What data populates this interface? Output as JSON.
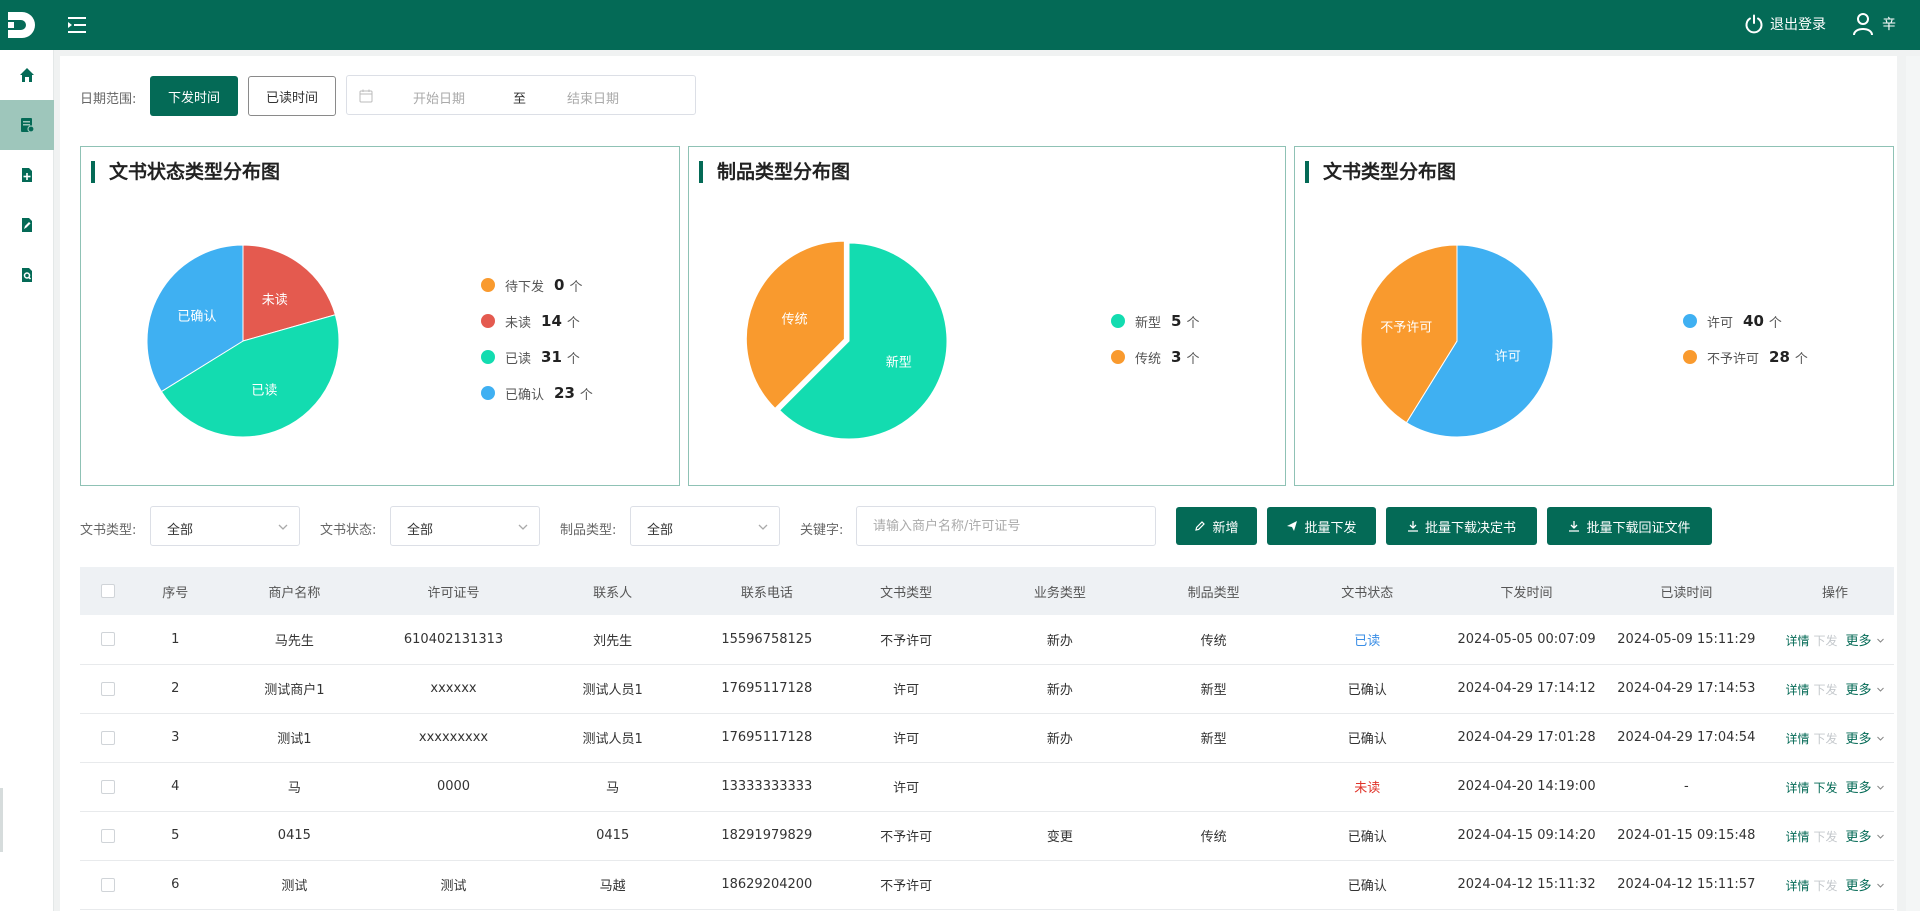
{
  "header": {
    "logout_label": "退出登录",
    "username": "辛"
  },
  "sidebar": {
    "items": [
      "home-icon",
      "document-list-icon",
      "add-file-icon",
      "edit-file-icon",
      "search-file-icon"
    ]
  },
  "filter": {
    "date_range_label": "日期范围:",
    "btn_issue_time": "下发时间",
    "btn_read_time": "已读时间",
    "start_placeholder": "开始日期",
    "separator": "至",
    "end_placeholder": "结束日期"
  },
  "colors": {
    "primary": "#046a56",
    "orange": "#f99a2e",
    "red": "#e45a4f",
    "teal": "#13dcb0",
    "blue": "#3fb0f2"
  },
  "chart_data": [
    {
      "type": "pie",
      "title": "文书状态类型分布图",
      "categories": [
        "待下发",
        "未读",
        "已读",
        "已确认"
      ],
      "values": [
        0,
        14,
        31,
        23
      ],
      "colors": [
        "#f99a2e",
        "#e45a4f",
        "#13dcb0",
        "#3fb0f2"
      ],
      "unit": "个",
      "legend": "right"
    },
    {
      "type": "pie",
      "title": "制品类型分布图",
      "categories": [
        "新型",
        "传统"
      ],
      "values": [
        5,
        3
      ],
      "colors": [
        "#13dcb0",
        "#f99a2e"
      ],
      "unit": "个",
      "legend": "right"
    },
    {
      "type": "pie",
      "title": "文书类型分布图",
      "categories": [
        "许可",
        "不予许可"
      ],
      "values": [
        40,
        28
      ],
      "colors": [
        "#3fb0f2",
        "#f99a2e"
      ],
      "unit": "个",
      "legend": "right"
    }
  ],
  "search": {
    "doc_type_label": "文书类型:",
    "doc_type_value": "全部",
    "doc_status_label": "文书状态:",
    "doc_status_value": "全部",
    "product_type_label": "制品类型:",
    "product_type_value": "全部",
    "keyword_label": "关键字:",
    "keyword_placeholder": "请输入商户名称/许可证号"
  },
  "actions": {
    "add": "新增",
    "batch_issue": "批量下发",
    "batch_download_decision": "批量下载决定书",
    "batch_download_receipt": "批量下载回证文件"
  },
  "table": {
    "columns": [
      "序号",
      "商户名称",
      "许可证号",
      "联系人",
      "联系电话",
      "文书类型",
      "业务类型",
      "制品类型",
      "文书状态",
      "下发时间",
      "已读时间",
      "操作"
    ],
    "op_detail": "详情",
    "op_issue": "下发",
    "op_more": "更多",
    "rows": [
      {
        "no": "1",
        "merchant": "马先生",
        "license": "610402131313",
        "contact": "刘先生",
        "phone": "15596758125",
        "doc_type": "不予许可",
        "biz_type": "新办",
        "product_type": "传统",
        "status": "已读",
        "status_color": "#3a8ee6",
        "issue_time": "2024-05-05 00:07:09",
        "read_time": "2024-05-09 15:11:29",
        "issue_enabled": false
      },
      {
        "no": "2",
        "merchant": "测试商户1",
        "license": "xxxxxx",
        "contact": "测试人员1",
        "phone": "17695117128",
        "doc_type": "许可",
        "biz_type": "新办",
        "product_type": "新型",
        "status": "已确认",
        "status_color": "#333333",
        "issue_time": "2024-04-29 17:14:12",
        "read_time": "2024-04-29 17:14:53",
        "issue_enabled": false
      },
      {
        "no": "3",
        "merchant": "测试1",
        "license": "xxxxxxxxx",
        "contact": "测试人员1",
        "phone": "17695117128",
        "doc_type": "许可",
        "biz_type": "新办",
        "product_type": "新型",
        "status": "已确认",
        "status_color": "#333333",
        "issue_time": "2024-04-29 17:01:28",
        "read_time": "2024-04-29 17:04:54",
        "issue_enabled": false
      },
      {
        "no": "4",
        "merchant": "马",
        "license": "0000",
        "contact": "马",
        "phone": "13333333333",
        "doc_type": "许可",
        "biz_type": "",
        "product_type": "",
        "status": "未读",
        "status_color": "#e0342a",
        "issue_time": "2024-04-20 14:19:00",
        "read_time": "-",
        "issue_enabled": true
      },
      {
        "no": "5",
        "merchant": "0415",
        "license": "",
        "contact": "0415",
        "phone": "18291979829",
        "doc_type": "不予许可",
        "biz_type": "变更",
        "product_type": "传统",
        "status": "已确认",
        "status_color": "#333333",
        "issue_time": "2024-04-15 09:14:20",
        "read_time": "2024-01-15 09:15:48",
        "issue_enabled": false
      },
      {
        "no": "6",
        "merchant": "测试",
        "license": "测试",
        "contact": "马越",
        "phone": "18629204200",
        "doc_type": "不予许可",
        "biz_type": "",
        "product_type": "",
        "status": "已确认",
        "status_color": "#333333",
        "issue_time": "2024-04-12 15:11:32",
        "read_time": "2024-04-12 15:11:57",
        "issue_enabled": false
      }
    ]
  }
}
